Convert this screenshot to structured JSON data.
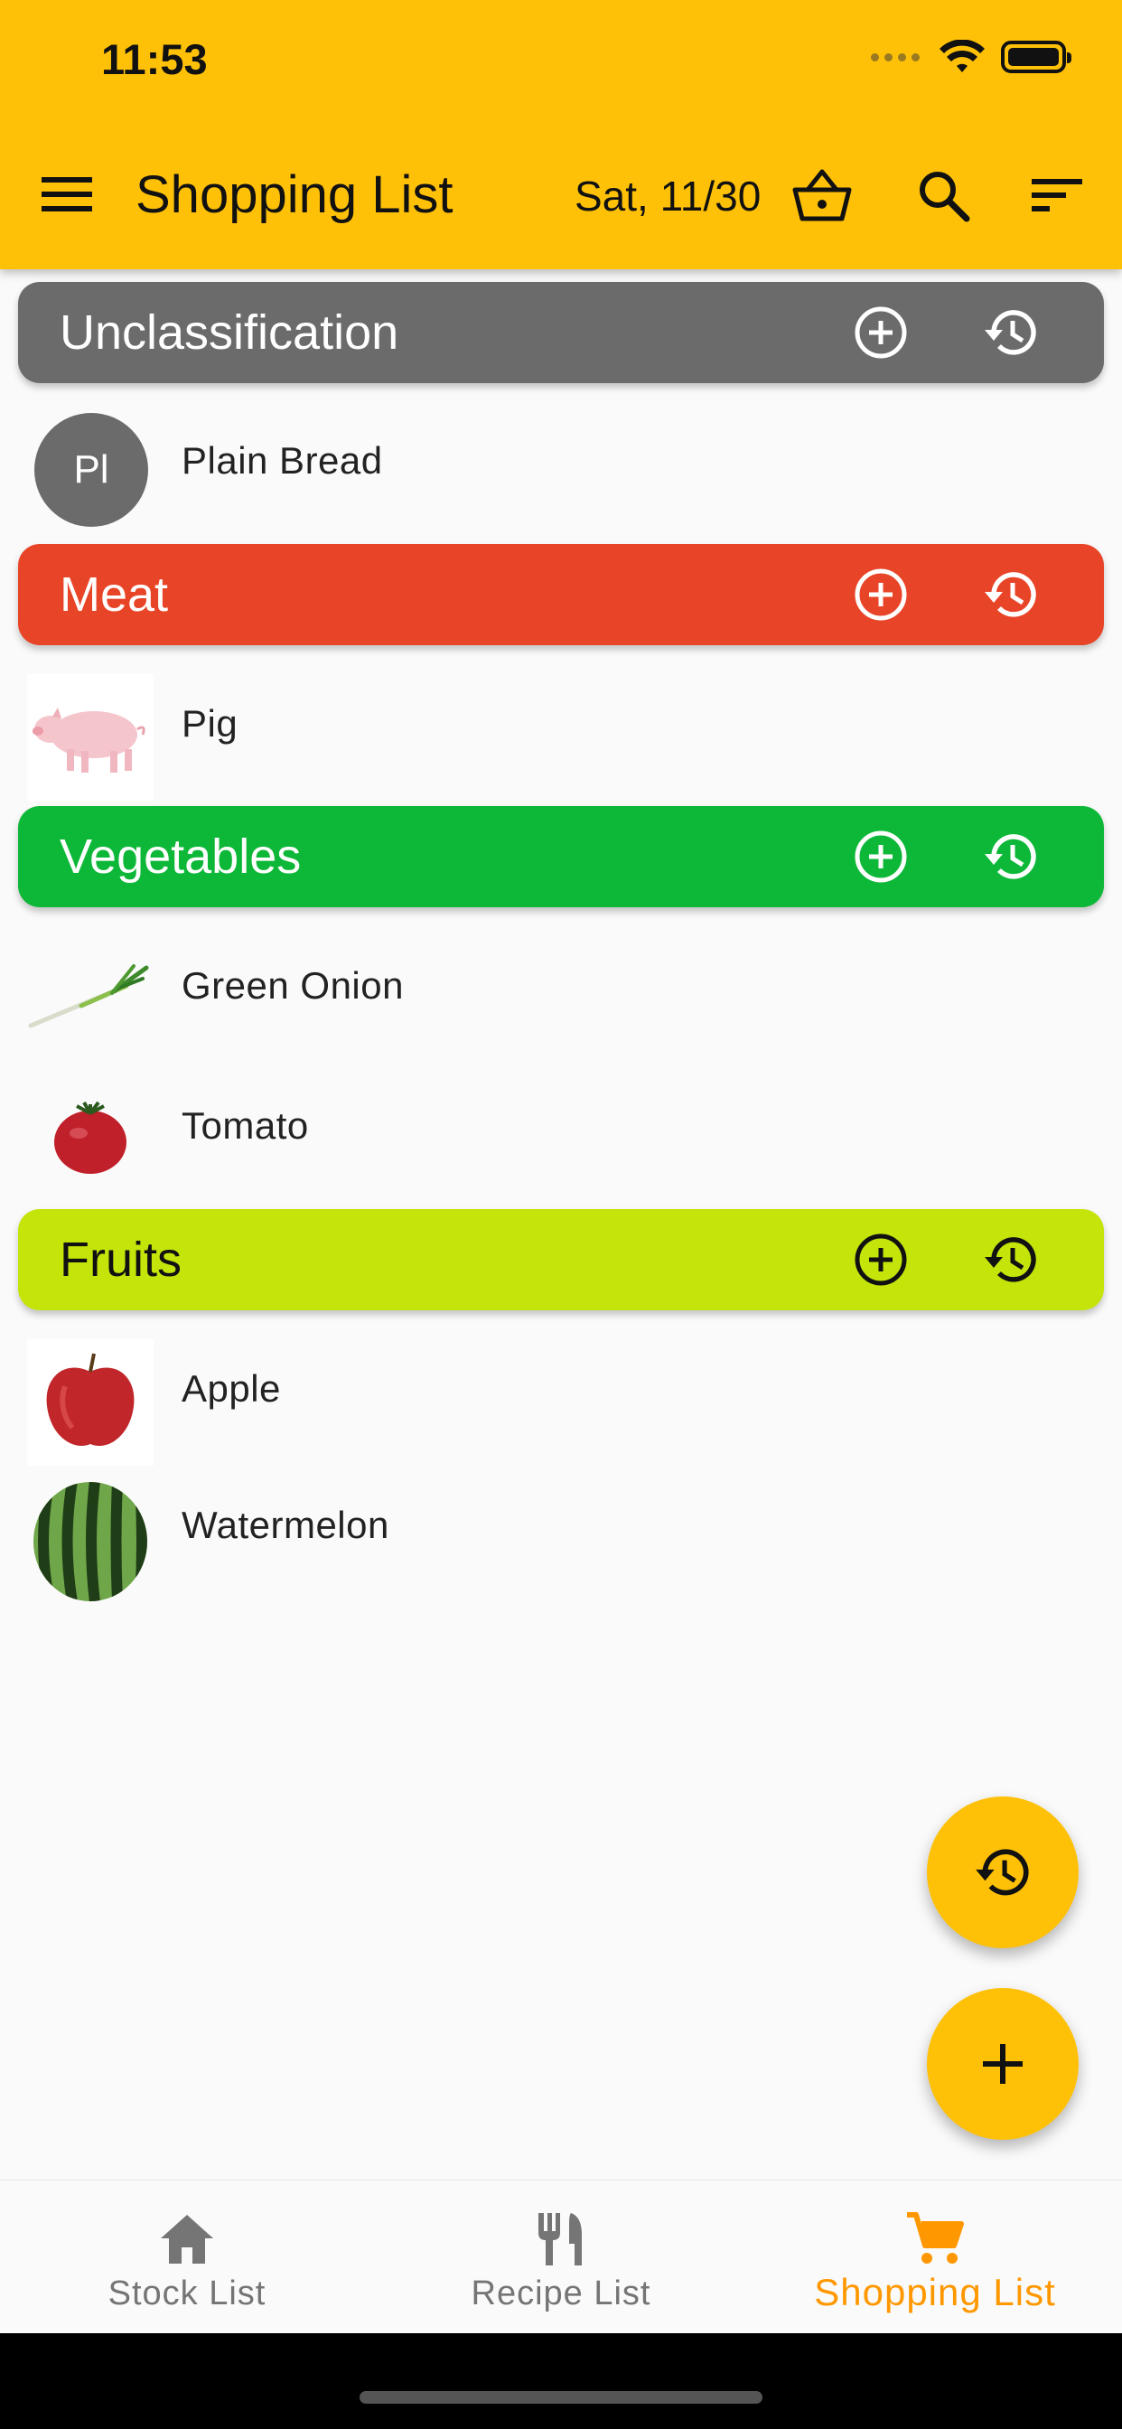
{
  "status": {
    "time": "11:53"
  },
  "appbar": {
    "title": "Shopping List",
    "date": "Sat, 11/30",
    "icons": [
      "menu-icon",
      "basket-icon",
      "search-icon",
      "sort-icon"
    ]
  },
  "categories": [
    {
      "name": "Unclassification",
      "color": "#6b6b6b",
      "text_color": "#ffffff",
      "items": [
        {
          "label": "Plain Bread",
          "avatar_text": "Pl"
        }
      ]
    },
    {
      "name": "Meat",
      "color": "#e84427",
      "text_color": "#ffffff",
      "items": [
        {
          "label": "Pig",
          "image": "pig-image"
        }
      ]
    },
    {
      "name": "Vegetables",
      "color": "#0db838",
      "text_color": "#ffffff",
      "items": [
        {
          "label": "Green Onion",
          "image": "green-onion-image"
        },
        {
          "label": "Tomato",
          "image": "tomato-image"
        }
      ]
    },
    {
      "name": "Fruits",
      "color": "#c4e40a",
      "text_color": "#111111",
      "items": [
        {
          "label": "Apple",
          "image": "apple-image"
        },
        {
          "label": "Watermelon",
          "image": "watermelon-image"
        }
      ]
    }
  ],
  "fabs": {
    "history_icon": "history-icon",
    "add_icon": "plus-icon",
    "color": "#ffc107"
  },
  "nav": {
    "items": [
      {
        "label": "Stock List",
        "icon": "home-icon"
      },
      {
        "label": "Recipe List",
        "icon": "utensils-icon"
      },
      {
        "label": "Shopping List",
        "icon": "cart-icon"
      }
    ],
    "active_index": 2,
    "active_color": "#ff9800"
  }
}
